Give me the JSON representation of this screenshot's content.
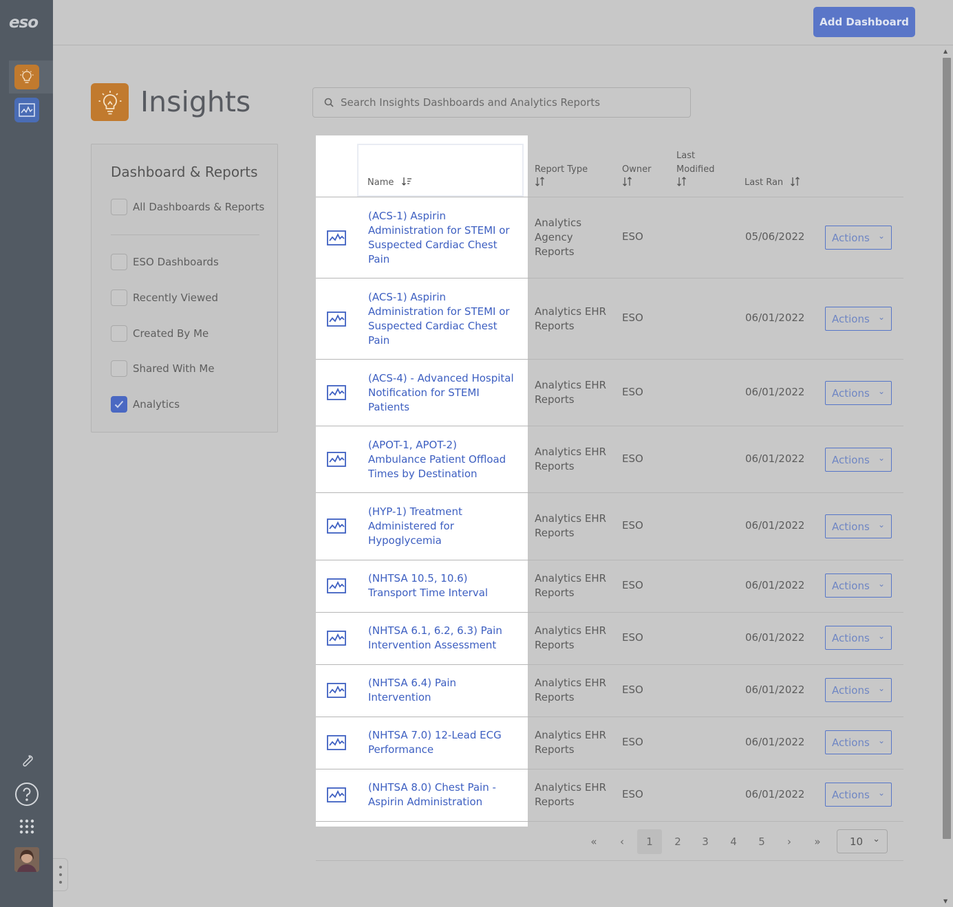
{
  "rail": {
    "logo": "eso"
  },
  "topbar": {
    "add_button": "Add Dashboard"
  },
  "header": {
    "title": "Insights",
    "search_placeholder": "Search Insights Dashboards and Analytics Reports"
  },
  "filters": {
    "title": "Dashboard & Reports",
    "items": [
      {
        "label": "All Dashboards & Reports",
        "checked": false
      },
      {
        "label": "ESO Dashboards",
        "checked": false
      },
      {
        "label": "Recently Viewed",
        "checked": false
      },
      {
        "label": "Created By Me",
        "checked": false
      },
      {
        "label": "Shared With Me",
        "checked": false
      },
      {
        "label": "Analytics",
        "checked": true
      }
    ]
  },
  "table": {
    "columns": {
      "name": "Name",
      "report_type": "Report Type",
      "owner": "Owner",
      "last_modified_1": "Last",
      "last_modified_2": "Modified",
      "last_ran": "Last Ran"
    },
    "rows": [
      {
        "name": "(ACS-1) Aspirin Administration for STEMI or Suspected Cardiac Chest Pain",
        "type": "Analytics Agency Reports",
        "owner": "ESO",
        "last_modified": "",
        "last_ran": "05/06/2022",
        "action": "Actions"
      },
      {
        "name": "(ACS-1) Aspirin Administration for STEMI or Suspected Cardiac Chest Pain",
        "type": "Analytics EHR Reports",
        "owner": "ESO",
        "last_modified": "",
        "last_ran": "06/01/2022",
        "action": "Actions"
      },
      {
        "name": "(ACS-4) - Advanced Hospital Notification for STEMI Patients",
        "type": "Analytics EHR Reports",
        "owner": "ESO",
        "last_modified": "",
        "last_ran": "06/01/2022",
        "action": "Actions"
      },
      {
        "name": "(APOT-1, APOT-2) Ambulance Patient Offload Times by Destination",
        "type": "Analytics EHR Reports",
        "owner": "ESO",
        "last_modified": "",
        "last_ran": "06/01/2022",
        "action": "Actions"
      },
      {
        "name": "(HYP-1) Treatment Administered for Hypoglycemia",
        "type": "Analytics EHR Reports",
        "owner": "ESO",
        "last_modified": "",
        "last_ran": "06/01/2022",
        "action": "Actions"
      },
      {
        "name": "(NHTSA 10.5, 10.6) Transport Time Interval",
        "type": "Analytics EHR Reports",
        "owner": "ESO",
        "last_modified": "",
        "last_ran": "06/01/2022",
        "action": "Actions"
      },
      {
        "name": "(NHTSA 6.1, 6.2, 6.3) Pain Intervention Assessment",
        "type": "Analytics EHR Reports",
        "owner": "ESO",
        "last_modified": "",
        "last_ran": "06/01/2022",
        "action": "Actions"
      },
      {
        "name": "(NHTSA 6.4) Pain Intervention",
        "type": "Analytics EHR Reports",
        "owner": "ESO",
        "last_modified": "",
        "last_ran": "06/01/2022",
        "action": "Actions"
      },
      {
        "name": "(NHTSA 7.0) 12-Lead ECG Performance",
        "type": "Analytics EHR Reports",
        "owner": "ESO",
        "last_modified": "",
        "last_ran": "06/01/2022",
        "action": "Actions"
      },
      {
        "name": "(NHTSA 8.0) Chest Pain - Aspirin Administration",
        "type": "Analytics EHR Reports",
        "owner": "ESO",
        "last_modified": "",
        "last_ran": "06/01/2022",
        "action": "Actions"
      }
    ]
  },
  "pagination": {
    "pages": [
      "1",
      "2",
      "3",
      "4",
      "5"
    ],
    "current_page": "1",
    "first": "«",
    "prev": "‹",
    "next": "›",
    "last": "»",
    "per_page": "10"
  },
  "colors": {
    "accent": "#4a68c2",
    "insights_orange": "#c17a2e",
    "link": "#3d5fc1"
  }
}
